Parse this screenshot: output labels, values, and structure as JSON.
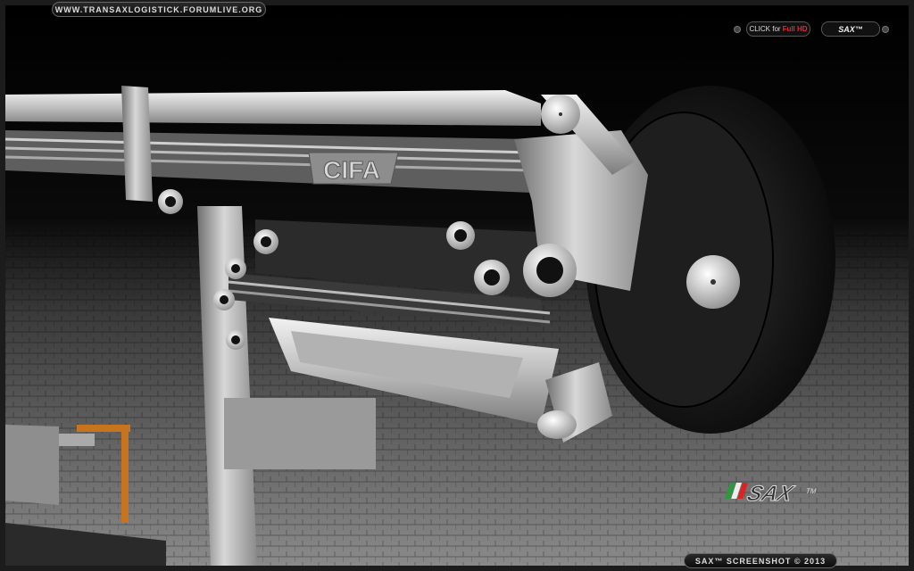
{
  "header": {
    "site_url": "WWW.TRANSAXLOGISTICK.FORUMLIVE.ORG",
    "full_hd_prefix": "CLICK for",
    "full_hd_highlight": "Full HD",
    "brand_badge": "SAX™"
  },
  "scene": {
    "part_logo": "CIFA",
    "watermark_logo": "SAX",
    "watermark_tm": "TM"
  },
  "footer": {
    "caption": "SAX™ SCREENSHOT © 2013"
  },
  "colors": {
    "floor": "#7a7a7a",
    "metal": "#cfcfcf",
    "drum": "#151515",
    "accent_red": "#e23333",
    "hazard_orange": "#c8741e"
  }
}
